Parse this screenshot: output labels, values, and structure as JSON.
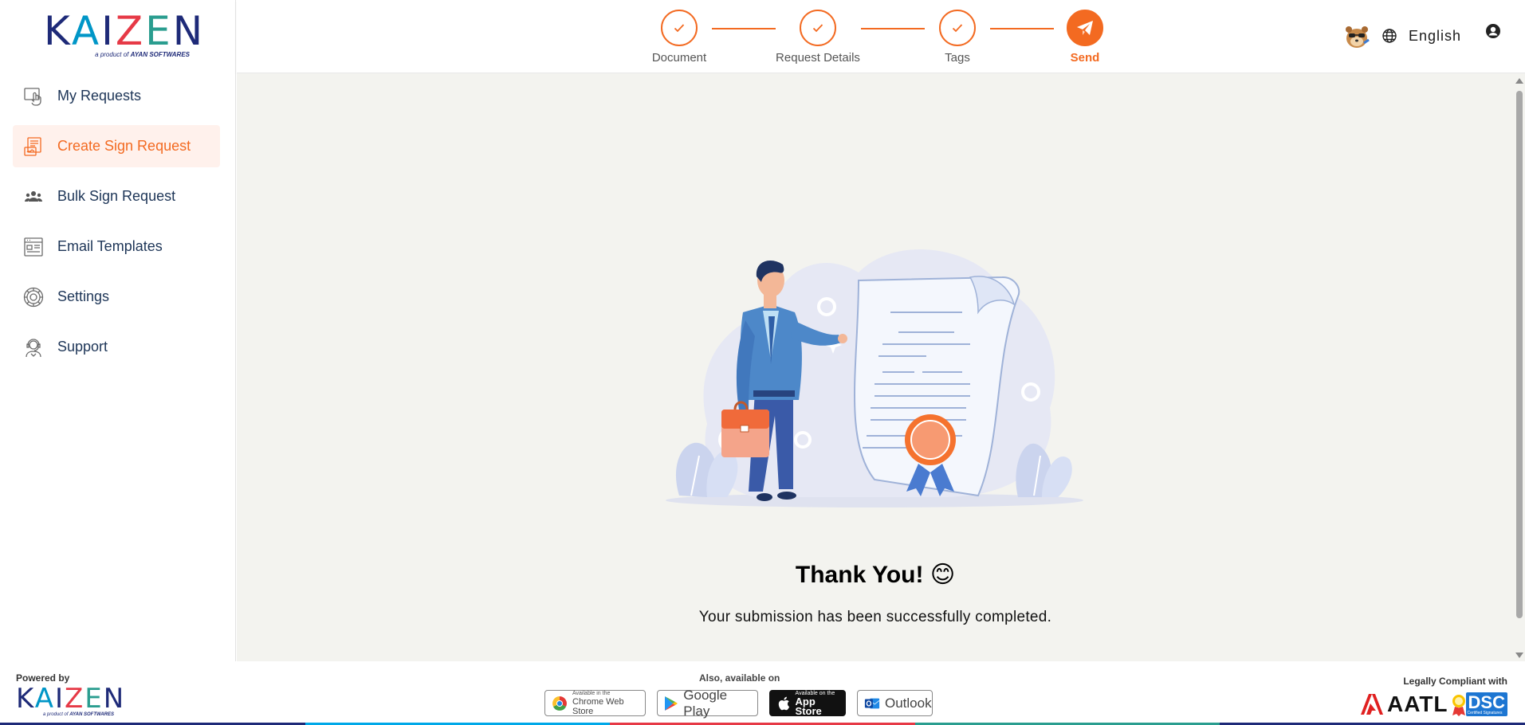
{
  "brand": {
    "name_parts": [
      "K",
      "A",
      "I",
      "Z",
      "E",
      "N"
    ],
    "tagline_prefix": "a product of ",
    "tagline_company": "AYAN SOFTWARES"
  },
  "sidebar": {
    "items": [
      {
        "label": "My Requests",
        "icon": "hand-pointer-icon",
        "active": false
      },
      {
        "label": "Create Sign Request",
        "icon": "document-sign-icon",
        "active": true
      },
      {
        "label": "Bulk Sign Request",
        "icon": "group-icon",
        "active": false
      },
      {
        "label": "Email Templates",
        "icon": "template-icon",
        "active": false
      },
      {
        "label": "Settings",
        "icon": "gear-icon",
        "active": false
      },
      {
        "label": "Support",
        "icon": "support-agent-icon",
        "active": false
      }
    ]
  },
  "stepper": {
    "steps": [
      {
        "label": "Document",
        "state": "done"
      },
      {
        "label": "Request Details",
        "state": "done"
      },
      {
        "label": "Tags",
        "state": "done"
      },
      {
        "label": "Send",
        "state": "active"
      }
    ]
  },
  "header": {
    "language": "English"
  },
  "main": {
    "title": "Thank You!",
    "title_emoji": "😊",
    "message": "Your submission has been successfully completed."
  },
  "footer": {
    "powered_by": "Powered by",
    "also_available": "Also, available on",
    "stores": [
      {
        "small": "Available in the",
        "big": "Chrome Web Store"
      },
      {
        "label": "Google Play"
      },
      {
        "small": "Available on the",
        "big": "App Store"
      },
      {
        "label": "Outlook"
      }
    ],
    "legally_compliant": "Legally Compliant with",
    "aatl": "AATL",
    "dsc": "DSC",
    "dsc_sub": "Certified Signatures"
  },
  "colors": {
    "accent": "#f36a21",
    "navy": "#1d3557",
    "main_bg": "#f3f3ef"
  }
}
